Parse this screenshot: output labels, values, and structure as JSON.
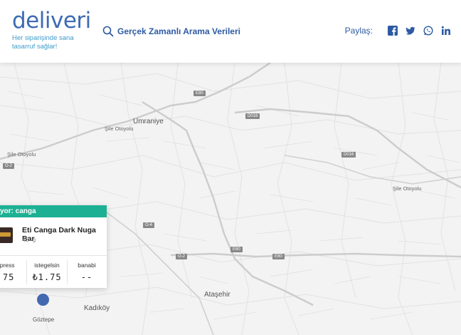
{
  "header": {
    "logo": "deliveri",
    "tagline": "Her siparişinde sana tasarruf sağlar!",
    "search_label": "Gerçek Zamanlı Arama Verileri",
    "share_label": "Paylaş:"
  },
  "social": [
    "facebook-icon",
    "twitter-icon",
    "whatsapp-icon",
    "linkedin-icon"
  ],
  "map": {
    "labels": [
      {
        "text": "Umraniye"
      },
      {
        "text": "Ataşehir"
      },
      {
        "text": "Kadıköy"
      },
      {
        "text": "Göztepe"
      },
      {
        "text": "Şile Otoyolu"
      },
      {
        "text": "Şile Otoyolu"
      },
      {
        "text": "Şile Otoyolu"
      }
    ],
    "shields": [
      "E80",
      "D016",
      "D016",
      "O-2",
      "O-4",
      "E80",
      "E80",
      "O-2"
    ]
  },
  "card": {
    "header": "yor: canga",
    "product_name": "Eti Canga Dark Nuga Bar",
    "product_weight": "45 g",
    "vendors": [
      {
        "name": "xpress",
        "price": ".75"
      },
      {
        "name": "istegelsin",
        "price": "₺1.75"
      },
      {
        "name": "banabi",
        "price": "--"
      }
    ]
  },
  "colors": {
    "brand": "#3d6bb3",
    "accent": "#1db093",
    "pin": "#4268b0"
  }
}
